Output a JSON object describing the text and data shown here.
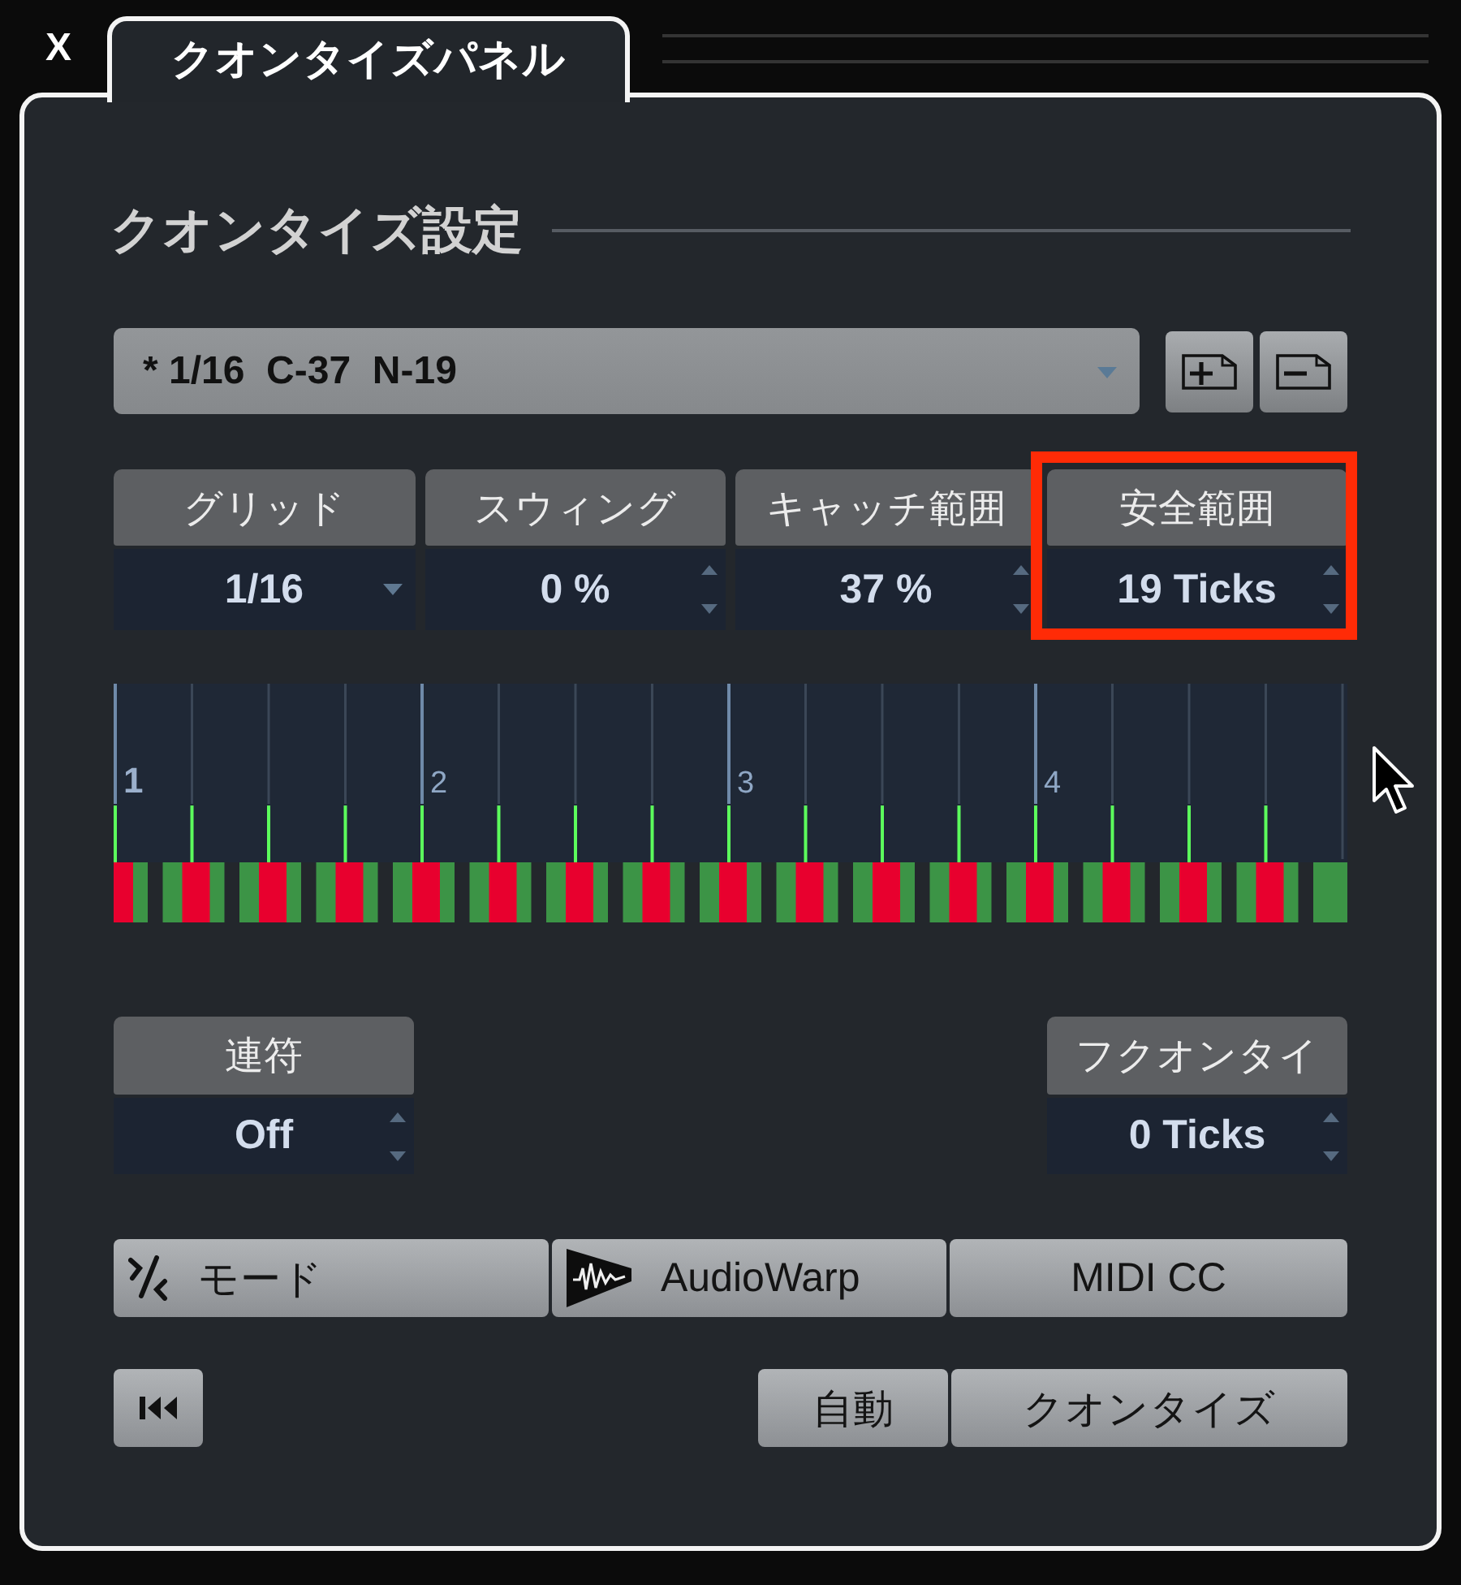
{
  "window": {
    "close": "X",
    "tab": "クオンタイズパネル"
  },
  "section": {
    "title": "クオンタイズ設定"
  },
  "preset": {
    "value": "* 1/16  C-37  N-19"
  },
  "parameters": [
    {
      "label": "グリッド",
      "value": "1/16",
      "kind": "dropdown",
      "highlighted": false
    },
    {
      "label": "スウィング",
      "value": "0 %",
      "kind": "spinner",
      "highlighted": false
    },
    {
      "label": "キャッチ範囲",
      "value": "37 %",
      "kind": "spinner",
      "highlighted": false
    },
    {
      "label": "安全範囲",
      "value": "19 Ticks",
      "kind": "spinner",
      "highlighted": true
    }
  ],
  "grid": {
    "beats": [
      "1",
      "2",
      "3",
      "4"
    ]
  },
  "lower_parameters": [
    {
      "label": "連符",
      "value": "Off",
      "kind": "spinner"
    },
    {
      "label": "フクオンタイ",
      "value": "0 Ticks",
      "kind": "spinner"
    }
  ],
  "mode_buttons": [
    {
      "label": "モード",
      "kind": "mode"
    },
    {
      "label": "AudioWarp",
      "kind": "warp"
    },
    {
      "label": "MIDI CC",
      "kind": "plain"
    }
  ],
  "apply_buttons": [
    {
      "label": "自動"
    },
    {
      "label": "クオンタイズ"
    }
  ]
}
